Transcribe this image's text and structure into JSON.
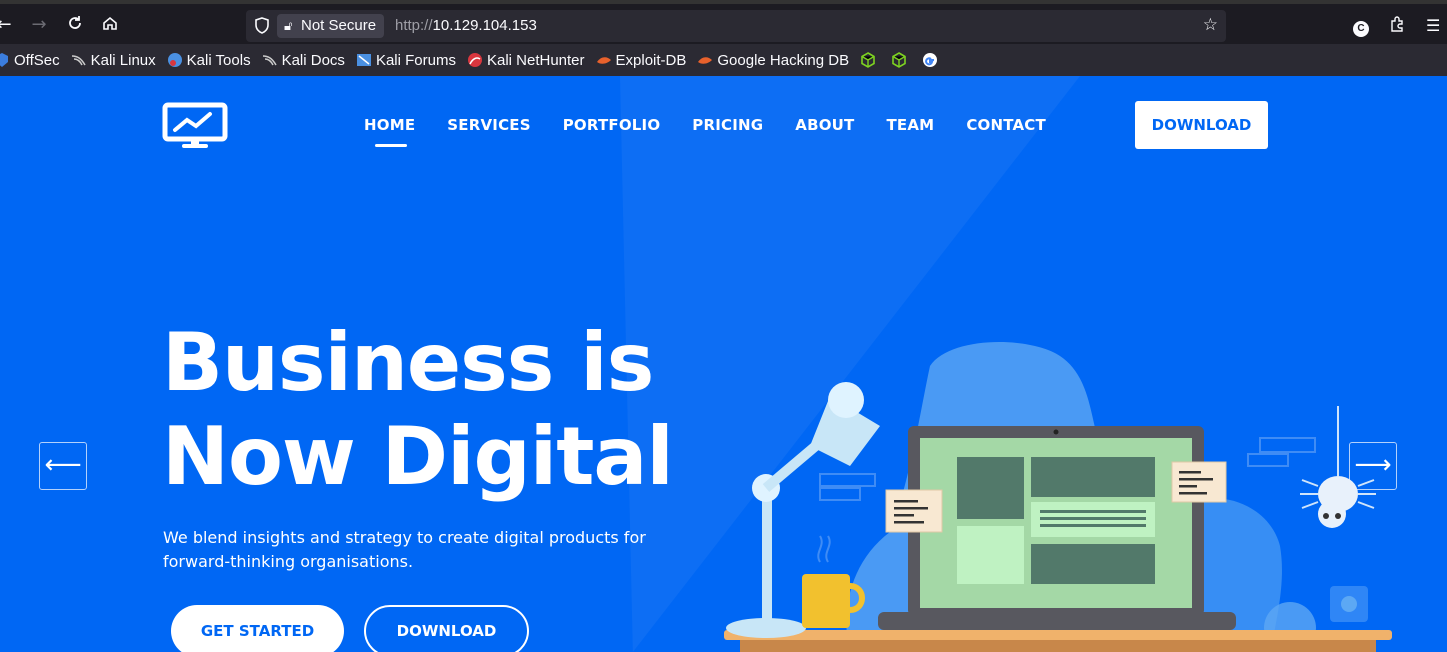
{
  "browser": {
    "not_secure_label": "Not Secure",
    "url_protocol": "http://",
    "url_host": "10.129.104.153",
    "profile_initial": "C",
    "bookmarks": [
      {
        "label": "OffSec",
        "icon": "offsec-icon",
        "color": "#3b7ddd"
      },
      {
        "label": "Kali Linux",
        "icon": "kali-dragon-icon",
        "color": "#cccccc"
      },
      {
        "label": "Kali Tools",
        "icon": "kali-tools-icon",
        "color": "#4a90e2"
      },
      {
        "label": "Kali Docs",
        "icon": "kali-dragon-icon",
        "color": "#cccccc"
      },
      {
        "label": "Kali Forums",
        "icon": "kali-forums-icon",
        "color": "#4a90e2"
      },
      {
        "label": "Kali NetHunter",
        "icon": "nethunter-icon",
        "color": "#d9363e"
      },
      {
        "label": "Exploit-DB",
        "icon": "exploitdb-icon",
        "color": "#e8612c"
      },
      {
        "label": "Google Hacking DB",
        "icon": "ghdb-icon",
        "color": "#e8612c"
      }
    ]
  },
  "site": {
    "nav": [
      "HOME",
      "SERVICES",
      "PORTFOLIO",
      "PRICING",
      "ABOUT",
      "TEAM",
      "CONTACT"
    ],
    "download_top": "DOWNLOAD",
    "hero_line1": "Business is",
    "hero_line2": "Now Digital",
    "hero_sub": "We blend insights and strategy to create digital products for forward-thinking organisations.",
    "btn_start": "GET STARTED",
    "btn_download": "DOWNLOAD",
    "arrow_left": "⟵",
    "arrow_right": "⟶",
    "colors": {
      "brand_blue": "#0067f4",
      "white": "#ffffff"
    }
  }
}
